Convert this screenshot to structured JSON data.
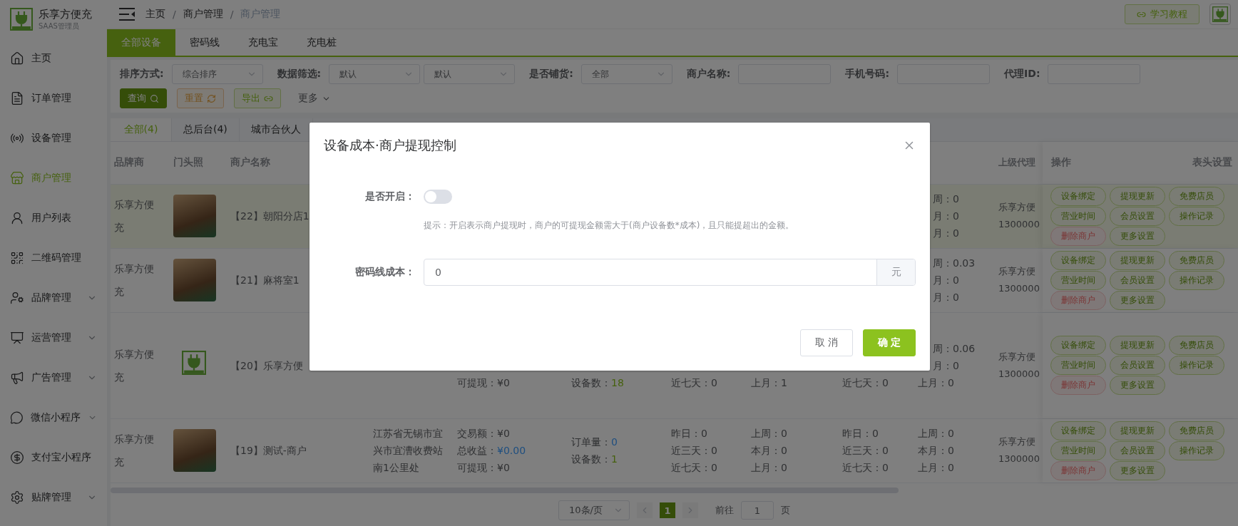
{
  "brand": {
    "name": "乐享方便充",
    "role": "SAAS管理员"
  },
  "sidebar": {
    "items": [
      {
        "label": "主页",
        "selected": false,
        "expandable": false
      },
      {
        "label": "订单管理",
        "selected": false,
        "expandable": false
      },
      {
        "label": "设备管理",
        "selected": false,
        "expandable": false
      },
      {
        "label": "商户管理",
        "selected": true,
        "expandable": false
      },
      {
        "label": "用户列表",
        "selected": false,
        "expandable": false
      },
      {
        "label": "二维码管理",
        "selected": false,
        "expandable": false
      },
      {
        "label": "品牌管理",
        "selected": false,
        "expandable": true
      },
      {
        "label": "运营管理",
        "selected": false,
        "expandable": true
      },
      {
        "label": "广告管理",
        "selected": false,
        "expandable": true
      },
      {
        "label": "微信小程序",
        "selected": false,
        "expandable": true
      },
      {
        "label": "支付宝小程序",
        "selected": false,
        "expandable": false
      },
      {
        "label": "贴牌管理",
        "selected": false,
        "expandable": true
      }
    ]
  },
  "breadcrumb": [
    {
      "label": "主页"
    },
    {
      "separator": "/",
      "label": "商户管理"
    },
    {
      "separator": "/",
      "label": "商户管理"
    }
  ],
  "tutorial_button": "学习教程",
  "device_tabs": [
    {
      "label": "全部设备",
      "selected": true
    },
    {
      "label": "密码线",
      "selected": false
    },
    {
      "label": "充电宝",
      "selected": false
    },
    {
      "label": "充电桩",
      "selected": false
    }
  ],
  "filters": [
    {
      "label": "排序方式:",
      "kind": "select",
      "values": [
        "综合排序"
      ]
    },
    {
      "label": "数据筛选:",
      "kind": "select",
      "values": [
        "默认",
        "默认"
      ]
    },
    {
      "label": "是否铺货:",
      "kind": "select",
      "values": [
        "全部"
      ]
    },
    {
      "label": "商户名称:",
      "kind": "input"
    },
    {
      "label": "手机号码:",
      "kind": "input"
    },
    {
      "label": "代理ID:",
      "kind": "input"
    }
  ],
  "filter_buttons": [
    {
      "label": "查询",
      "kind": "primary"
    },
    {
      "label": "重置",
      "kind": "reset"
    },
    {
      "label": "导出",
      "kind": "export"
    },
    {
      "label": "更多",
      "kind": "more"
    }
  ],
  "sub_tabs": [
    {
      "label": "全部(4)",
      "selected": true
    },
    {
      "label": "总后台(4)",
      "selected": false
    },
    {
      "label": "城市合伙人",
      "selected": false
    }
  ],
  "table": {
    "columns": [
      "品牌商",
      "门头照",
      "商户名称",
      "上级代理",
      "操作"
    ],
    "header_settings": "表头设置",
    "rows": [
      {
        "highlighted": true,
        "brand": "乐享方便充",
        "photo": {
          "kind": "photo"
        },
        "name": "【22】朝阳分店1",
        "stats_4": [
          {
            "text": "周：0",
            "partial": true
          },
          {
            "text": "月：0",
            "partial": true
          },
          {
            "text": "月：0",
            "partial": true
          }
        ],
        "agent": [
          "乐享方便",
          "1300000"
        ],
        "actions": [
          {
            "label": "设备绑定",
            "kind": "normal"
          },
          {
            "label": "提现更新",
            "kind": "normal"
          },
          {
            "label": "免费店员",
            "kind": "normal"
          },
          {
            "label": "营业时间",
            "kind": "normal"
          },
          {
            "label": "会员设置",
            "kind": "normal"
          },
          {
            "label": "操作记录",
            "kind": "normal"
          },
          {
            "label": "删除商户",
            "kind": "danger"
          },
          {
            "label": "更多设置",
            "kind": "normal"
          }
        ]
      },
      {
        "highlighted": false,
        "brand": "乐享方便充",
        "photo": {
          "kind": "photo"
        },
        "name": "【21】麻将室1",
        "stats_4": [
          {
            "text": "周：0.03",
            "partial": true
          },
          {
            "text": "月：0",
            "partial": true
          },
          {
            "text": "月：0",
            "partial": true
          }
        ],
        "agent": [
          "乐享方便",
          "1300000"
        ],
        "actions": [
          {
            "label": "设备绑定",
            "kind": "normal"
          },
          {
            "label": "提现更新",
            "kind": "normal"
          },
          {
            "label": "免费店员",
            "kind": "normal"
          },
          {
            "label": "营业时间",
            "kind": "normal"
          },
          {
            "label": "会员设置",
            "kind": "normal"
          },
          {
            "label": "操作记录",
            "kind": "normal"
          },
          {
            "label": "删除商户",
            "kind": "danger"
          },
          {
            "label": "更多设置",
            "kind": "normal"
          }
        ]
      },
      {
        "highlighted": false,
        "brand": "乐享方便充",
        "photo": {
          "kind": "logo"
        },
        "name": "【20】乐享方便",
        "income": [
          {
            "label": "可提现：",
            "value": "¥0",
            "kind": "plain"
          }
        ],
        "orders": [
          {
            "label": "设备数：",
            "value": "18",
            "kind": "count"
          }
        ],
        "stats_1": [
          {
            "text": "近七天：0",
            "partial": false
          }
        ],
        "stats_2": [
          {
            "text": "上月：1",
            "partial": false
          }
        ],
        "stats_3": [
          {
            "text": "近七天：0",
            "partial": false
          }
        ],
        "stats_4": [
          {
            "text": "周：0.06",
            "partial": true
          },
          {
            "text": "月：0",
            "partial": true
          },
          {
            "text": "上月：0",
            "partial": false
          }
        ],
        "agent": [
          "乐享方便",
          "1300000"
        ],
        "actions": [
          {
            "label": "设备绑定",
            "kind": "normal"
          },
          {
            "label": "提现更新",
            "kind": "normal"
          },
          {
            "label": "免费店员",
            "kind": "normal"
          },
          {
            "label": "营业时间",
            "kind": "normal"
          },
          {
            "label": "会员设置",
            "kind": "normal"
          },
          {
            "label": "操作记录",
            "kind": "normal"
          },
          {
            "label": "删除商户",
            "kind": "danger"
          },
          {
            "label": "更多设置",
            "kind": "normal"
          }
        ]
      },
      {
        "highlighted": false,
        "brand": "乐享方便充",
        "photo": {
          "kind": "photo"
        },
        "name": "【19】测试-商户",
        "address": "江苏省无锡市宜兴市宜漕收费站南1公里处",
        "income": [
          {
            "label": "交易额：",
            "value": "¥0",
            "kind": "plain"
          },
          {
            "label": "总收益：",
            "value": "¥0.00",
            "kind": "link"
          },
          {
            "label": "可提现：",
            "value": "¥0",
            "kind": "plain"
          }
        ],
        "orders": [
          {
            "label": "订单量：",
            "value": "0",
            "kind": "link"
          },
          {
            "label": "设备数：",
            "value": "1",
            "kind": "count"
          }
        ],
        "stats_1": [
          {
            "text": "昨日：0",
            "partial": false
          },
          {
            "text": "近三天：0",
            "partial": false
          },
          {
            "text": "近七天：0",
            "partial": false
          }
        ],
        "stats_2": [
          {
            "text": "上周：0",
            "partial": false
          },
          {
            "text": "本月：0",
            "partial": false
          },
          {
            "text": "上月：0",
            "partial": false
          }
        ],
        "stats_3": [
          {
            "text": "昨日：0",
            "partial": false
          },
          {
            "text": "近三天：0",
            "partial": false
          },
          {
            "text": "近七天：0",
            "partial": false
          }
        ],
        "stats_4": [
          {
            "text": "上周：0",
            "partial": false
          },
          {
            "text": "本月：0",
            "partial": false
          },
          {
            "text": "上月：0",
            "partial": false
          }
        ],
        "agent": [
          "乐享方便",
          "1300000"
        ],
        "actions": [
          {
            "label": "设备绑定",
            "kind": "normal"
          },
          {
            "label": "提现更新",
            "kind": "normal"
          },
          {
            "label": "免费店员",
            "kind": "normal"
          },
          {
            "label": "营业时间",
            "kind": "normal"
          },
          {
            "label": "会员设置",
            "kind": "normal"
          },
          {
            "label": "操作记录",
            "kind": "normal"
          },
          {
            "label": "删除商户",
            "kind": "danger"
          },
          {
            "label": "更多设置",
            "kind": "normal"
          }
        ]
      }
    ]
  },
  "pagination": {
    "page_size": "10条/页",
    "pages": [
      {
        "label": "1",
        "selected": true
      }
    ],
    "goto_label": "前往",
    "goto_value": "1",
    "goto_unit": "页"
  },
  "dialog": {
    "title": "设备成本·商户提现控制",
    "enabled": {
      "label": "是否开启：",
      "on": false
    },
    "hint": "提示：开启表示商户提现时，商户的可提现金额需大于(商户设备数*成本)，且只能提超出的金额。",
    "cost": {
      "label": "密码线成本：",
      "value": "0",
      "unit": "元"
    },
    "buttons": [
      {
        "label": "取 消",
        "kind": "secondary"
      },
      {
        "label": "确 定",
        "kind": "primary"
      }
    ]
  }
}
